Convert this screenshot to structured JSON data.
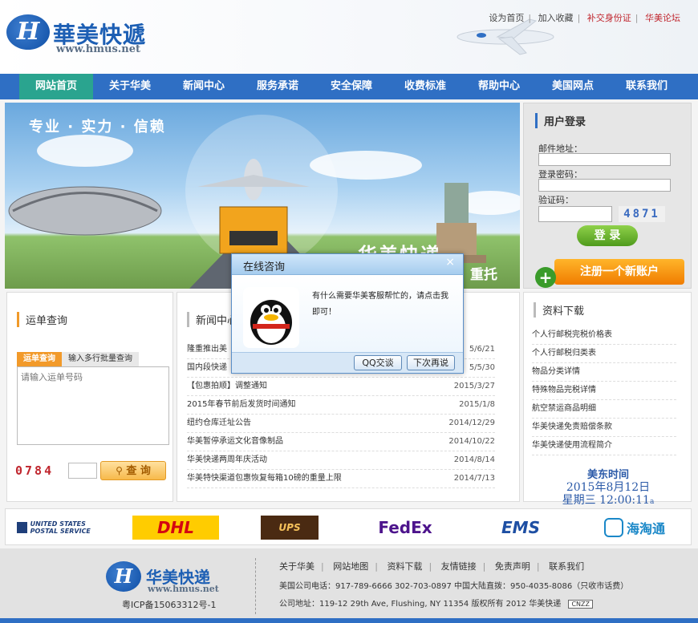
{
  "header": {
    "logo_mark": "H",
    "logo_name": "華美快遞",
    "logo_url": "www.hmus.net",
    "top_links": [
      "设为首页",
      "加入收藏",
      "补交身份证",
      "华美论坛"
    ]
  },
  "nav": {
    "items": [
      "网站首页",
      "关于华美",
      "新闻中心",
      "服务承诺",
      "安全保障",
      "收费标准",
      "帮助中心",
      "美国网点",
      "联系我们"
    ],
    "active_index": 0
  },
  "banner": {
    "slogan": "专业 · 实力 · 信赖",
    "brand": "华美快递",
    "brand_tail": "重托"
  },
  "login": {
    "title": "用户登录",
    "email_label": "邮件地址：",
    "password_label": "登录密码：",
    "captcha_label": "验证码：",
    "captcha_code": "4871",
    "login_button": "登 录",
    "register_button": "注册一个新账户"
  },
  "tracking": {
    "title": "运单查询",
    "tab_active": "运单查询",
    "tab_other": "输入多行批量查询",
    "placeholder": "请输入运单号码",
    "captcha_code": "0784",
    "query_button": "查 询"
  },
  "news": {
    "title": "新闻中心",
    "items": [
      {
        "title": "隆重推出美",
        "date": "5/6/21"
      },
      {
        "title": "国内段快递",
        "date": "5/5/30"
      },
      {
        "title": "【包惠拍顺】调整通知",
        "date": "2015/3/27"
      },
      {
        "title": "2015年春节前后发货时间通知",
        "date": "2015/1/8"
      },
      {
        "title": "纽约仓库迁址公告",
        "date": "2014/12/29"
      },
      {
        "title": "华美暂停承运文化音像制品",
        "date": "2014/10/22"
      },
      {
        "title": "华美快递两周年庆活动",
        "date": "2014/8/14"
      },
      {
        "title": "华美特快渠道包惠恢复每箱10磅的重量上限",
        "date": "2014/7/13"
      }
    ]
  },
  "downloads": {
    "title": "资料下载",
    "items": [
      "个人行邮税完税价格表",
      "个人行邮税归类表",
      "物品分类详情",
      "特殊物品完税详情",
      "航空禁运商品明细",
      "华美快递免责赔偿条款",
      "华美快递使用流程简介"
    ]
  },
  "clock": {
    "label": "美东时间",
    "date": "2015年8月12日",
    "weekday_time": "星期三 12:00:11",
    "suffix": "a"
  },
  "partners": [
    {
      "name": "UNITED STATES POSTAL SERVICE",
      "color": "#1f3f7a"
    },
    {
      "name": "DHL",
      "color": "#d40511",
      "bg": "#ffcc00"
    },
    {
      "name": "UPS",
      "color": "#f5c15a",
      "bg": "#4a2a12"
    },
    {
      "name": "FedEx",
      "color": "#4d148c",
      "accent": "#ff6600"
    },
    {
      "name": "EMS",
      "color": "#1e4fa3",
      "accent": "#e4701e"
    },
    {
      "name": "海淘通",
      "color": "#1b88c8"
    }
  ],
  "footer": {
    "logo_mark": "H",
    "logo_name": "华美快递",
    "logo_url": "www.hmus.net",
    "icp": "粤ICP备15063312号-1",
    "links": [
      "关于华美",
      "网站地图",
      "资料下载",
      "友情链接",
      "免责声明",
      "联系我们"
    ],
    "phone_line": "美国公司电话：917-789-6666 302-703-0897  中国大陆直拨：950-4035-8086（只收市话费）",
    "address_line": "公司地址：119-12 29th Ave, Flushing, NY 11354  版权所有 2012 华美快递",
    "badge": "CNZZ"
  },
  "dialog": {
    "title": "在线咨询",
    "close": "×",
    "message": "有什么需要华美客服帮忙的，请点击我即可！",
    "qq_button": "QQ交谈",
    "later_button": "下次再说"
  },
  "colors": {
    "nav_bg": "#2f6fc4",
    "nav_active": "#2aa48f",
    "accent_orange": "#f29a2a",
    "brand_blue": "#1d5fb4"
  }
}
